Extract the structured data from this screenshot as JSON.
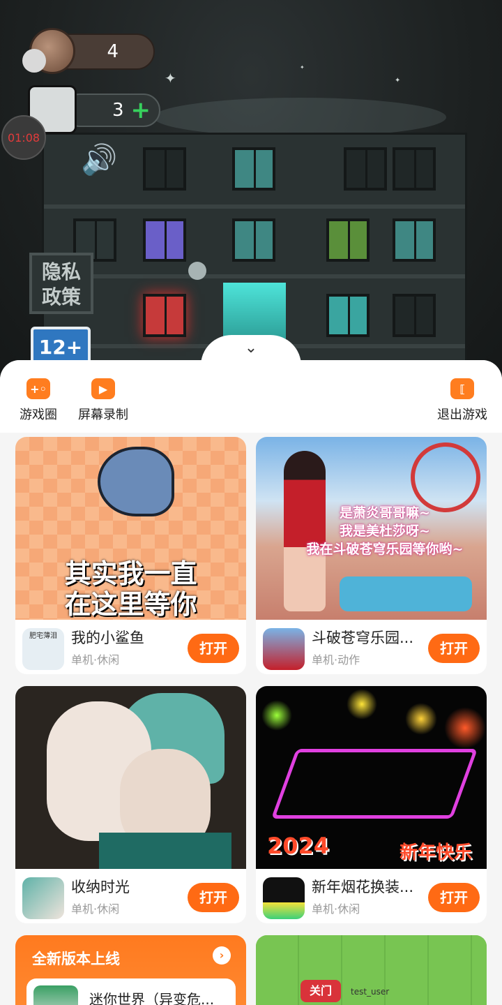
{
  "hud": {
    "coin_count": "4",
    "life_count": "3",
    "life_add": "+",
    "timer": "01:08",
    "privacy_badge": "隐私\n政策",
    "age_badge": "12+",
    "collapse": "⌄"
  },
  "toolbar": {
    "game_circle": "游戏圈",
    "game_circle_icon": "+◦",
    "screen_record": "屏幕录制",
    "screen_record_icon": "▶",
    "exit_game": "退出游戏",
    "exit_icon": "⟦"
  },
  "games": [
    {
      "name": "我的小鲨鱼",
      "tag": "单机·休闲",
      "button": "打开",
      "overlay": "其实我一直\n在这里等你",
      "icon_text": "肥宅薄泪"
    },
    {
      "name": "斗破苍穹乐园...",
      "tag": "单机·动作",
      "button": "打开",
      "overlay": "是萧炎哥哥嘛~\n我是美杜莎呀~\n我在斗破苍穹乐园等你哟~"
    },
    {
      "name": "收纳时光",
      "tag": "单机·休闲",
      "button": "打开"
    },
    {
      "name": "新年烟花换装...",
      "tag": "单机·休闲",
      "button": "打开",
      "overlay_year": "2024",
      "overlay_greeting": "新年快乐"
    }
  ],
  "promo": {
    "title": "全新版本上线",
    "arrow": "›",
    "game_name": "迷你世界（异变危..."
  },
  "card6": {
    "label": "关门",
    "user": "test_user"
  },
  "colors": {
    "accent": "#ff6a14",
    "timer_text": "#e33b3b",
    "life_plus": "#37d05d"
  }
}
